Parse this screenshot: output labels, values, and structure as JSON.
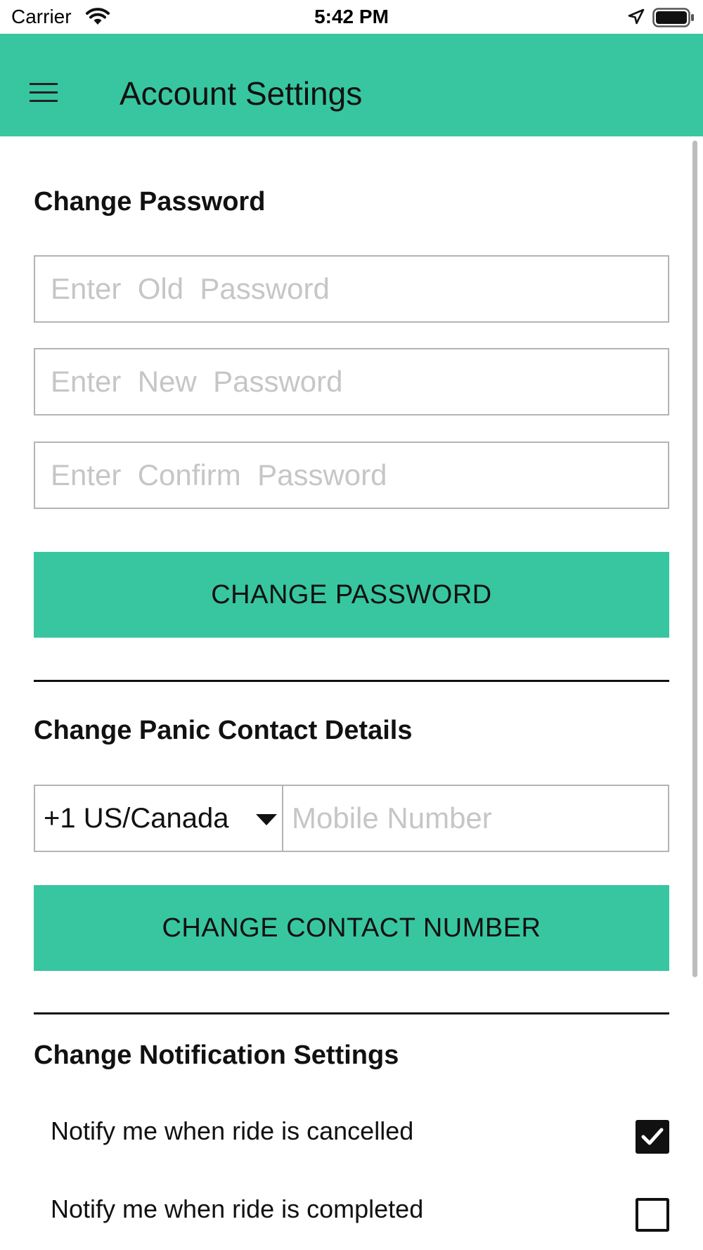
{
  "status_bar": {
    "carrier": "Carrier",
    "time": "5:42 PM"
  },
  "header": {
    "title": "Account Settings",
    "menu_icon": "hamburger-menu-icon",
    "background": "#38c6a0"
  },
  "password_section": {
    "title": "Change Password",
    "old_placeholder": "Enter  Old  Password",
    "new_placeholder": "Enter  New  Password",
    "confirm_placeholder": "Enter  Confirm  Password",
    "button_label": "CHANGE PASSWORD"
  },
  "panic_section": {
    "title": "Change Panic Contact Details",
    "country_code": "+1 US/Canada",
    "mobile_placeholder": "Mobile Number",
    "button_label": "CHANGE CONTACT NUMBER"
  },
  "notification_section": {
    "title": "Change Notification Settings",
    "items": [
      {
        "label": "Notify me when ride is cancelled",
        "checked": true
      },
      {
        "label": "Notify me when ride is completed",
        "checked": false
      }
    ]
  },
  "colors": {
    "accent": "#38c6a0",
    "input_border": "#b4b4b4",
    "placeholder": "#c6c6c6"
  }
}
